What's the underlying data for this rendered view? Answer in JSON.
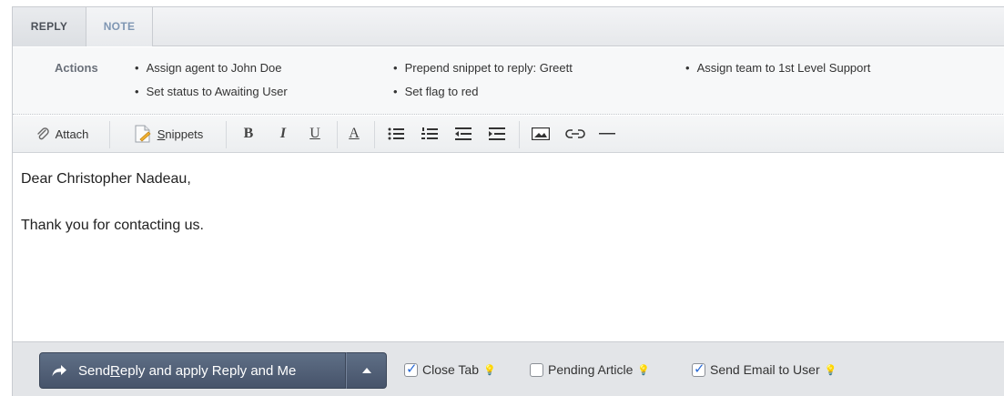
{
  "tabs": {
    "reply": "REPLY",
    "note": "NOTE"
  },
  "actions": {
    "label": "Actions",
    "items": [
      "Assign agent to John Doe",
      "Set status to Awaiting User",
      "Prepend snippet to reply: Greett",
      "Set flag to red",
      "Assign team to 1st Level Support"
    ]
  },
  "toolbar": {
    "attach": "Attach",
    "snippets_first": "S",
    "snippets_rest": "nippets",
    "bold": "B",
    "italic": "I",
    "underline": "U",
    "font_color": "A"
  },
  "editor": {
    "lines": [
      "Dear Christopher Nadeau,",
      "Thank you for contacting us."
    ]
  },
  "bottom": {
    "send_prefix": "Send ",
    "send_underlined": "R",
    "send_rest": "eply and apply Reply and Me",
    "checkboxes": [
      {
        "label": "Close Tab",
        "checked": true
      },
      {
        "label": "Pending Article",
        "checked": false
      },
      {
        "label": "Send Email to User",
        "checked": true
      }
    ]
  }
}
